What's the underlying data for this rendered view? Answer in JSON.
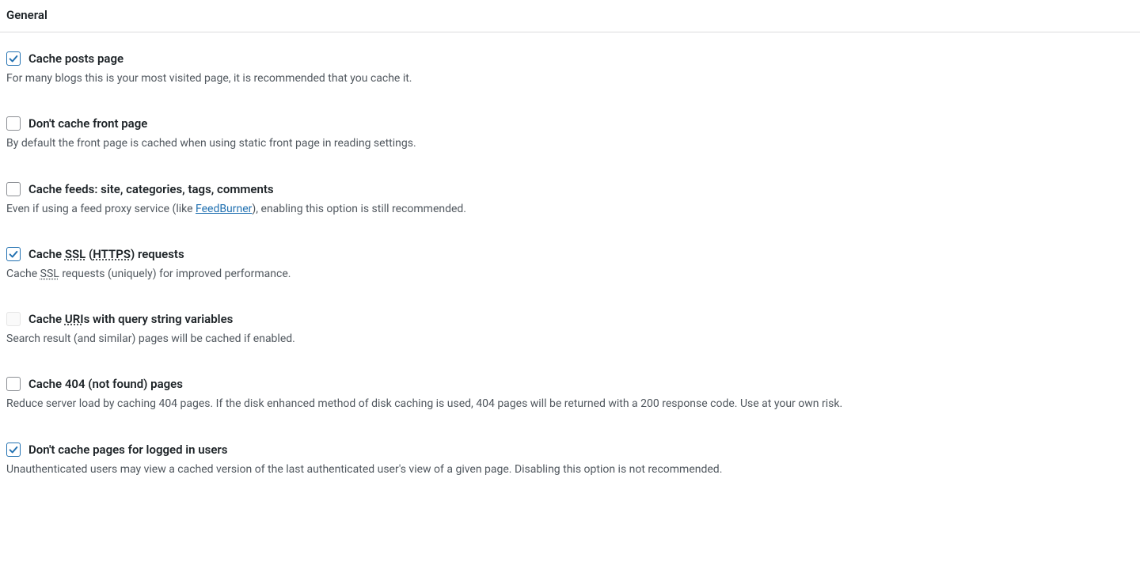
{
  "section_title": "General",
  "options": [
    {
      "id": "cache-posts-page",
      "checked": true,
      "disabled": false,
      "label_parts": [
        {
          "t": "text",
          "v": "Cache posts page"
        }
      ],
      "desc_parts": [
        {
          "t": "text",
          "v": "For many blogs this is your most visited page, it is recommended that you cache it."
        }
      ]
    },
    {
      "id": "dont-cache-front-page",
      "checked": false,
      "disabled": false,
      "label_parts": [
        {
          "t": "text",
          "v": "Don't cache front page"
        }
      ],
      "desc_parts": [
        {
          "t": "text",
          "v": "By default the front page is cached when using static front page in reading settings."
        }
      ]
    },
    {
      "id": "cache-feeds",
      "checked": false,
      "disabled": false,
      "label_parts": [
        {
          "t": "text",
          "v": "Cache feeds: site, categories, tags, comments"
        }
      ],
      "desc_parts": [
        {
          "t": "text",
          "v": "Even if using a feed proxy service (like "
        },
        {
          "t": "link",
          "v": "FeedBurner"
        },
        {
          "t": "text",
          "v": "), enabling this option is still recommended."
        }
      ]
    },
    {
      "id": "cache-ssl-requests",
      "checked": true,
      "disabled": false,
      "label_parts": [
        {
          "t": "text",
          "v": "Cache "
        },
        {
          "t": "abbr",
          "v": "SSL"
        },
        {
          "t": "text",
          "v": " ("
        },
        {
          "t": "abbr",
          "v": "HTTPS"
        },
        {
          "t": "text",
          "v": ") requests"
        }
      ],
      "desc_parts": [
        {
          "t": "text",
          "v": "Cache "
        },
        {
          "t": "abbr",
          "v": "SSL"
        },
        {
          "t": "text",
          "v": " requests (uniquely) for improved performance."
        }
      ]
    },
    {
      "id": "cache-uris-query-string",
      "checked": false,
      "disabled": true,
      "label_parts": [
        {
          "t": "text",
          "v": "Cache "
        },
        {
          "t": "abbr",
          "v": "URI"
        },
        {
          "t": "text",
          "v": "s with query string variables"
        }
      ],
      "desc_parts": [
        {
          "t": "text",
          "v": "Search result (and similar) pages will be cached if enabled."
        }
      ]
    },
    {
      "id": "cache-404-pages",
      "checked": false,
      "disabled": false,
      "label_parts": [
        {
          "t": "text",
          "v": "Cache 404 (not found) pages"
        }
      ],
      "desc_parts": [
        {
          "t": "text",
          "v": "Reduce server load by caching 404 pages. If the disk enhanced method of disk caching is used, 404 pages will be returned with a 200 response code. Use at your own risk."
        }
      ]
    },
    {
      "id": "dont-cache-logged-in",
      "checked": true,
      "disabled": false,
      "label_parts": [
        {
          "t": "text",
          "v": "Don't cache pages for logged in users"
        }
      ],
      "desc_parts": [
        {
          "t": "text",
          "v": "Unauthenticated users may view a cached version of the last authenticated user's view of a given page. Disabling this option is not recommended."
        }
      ]
    }
  ]
}
